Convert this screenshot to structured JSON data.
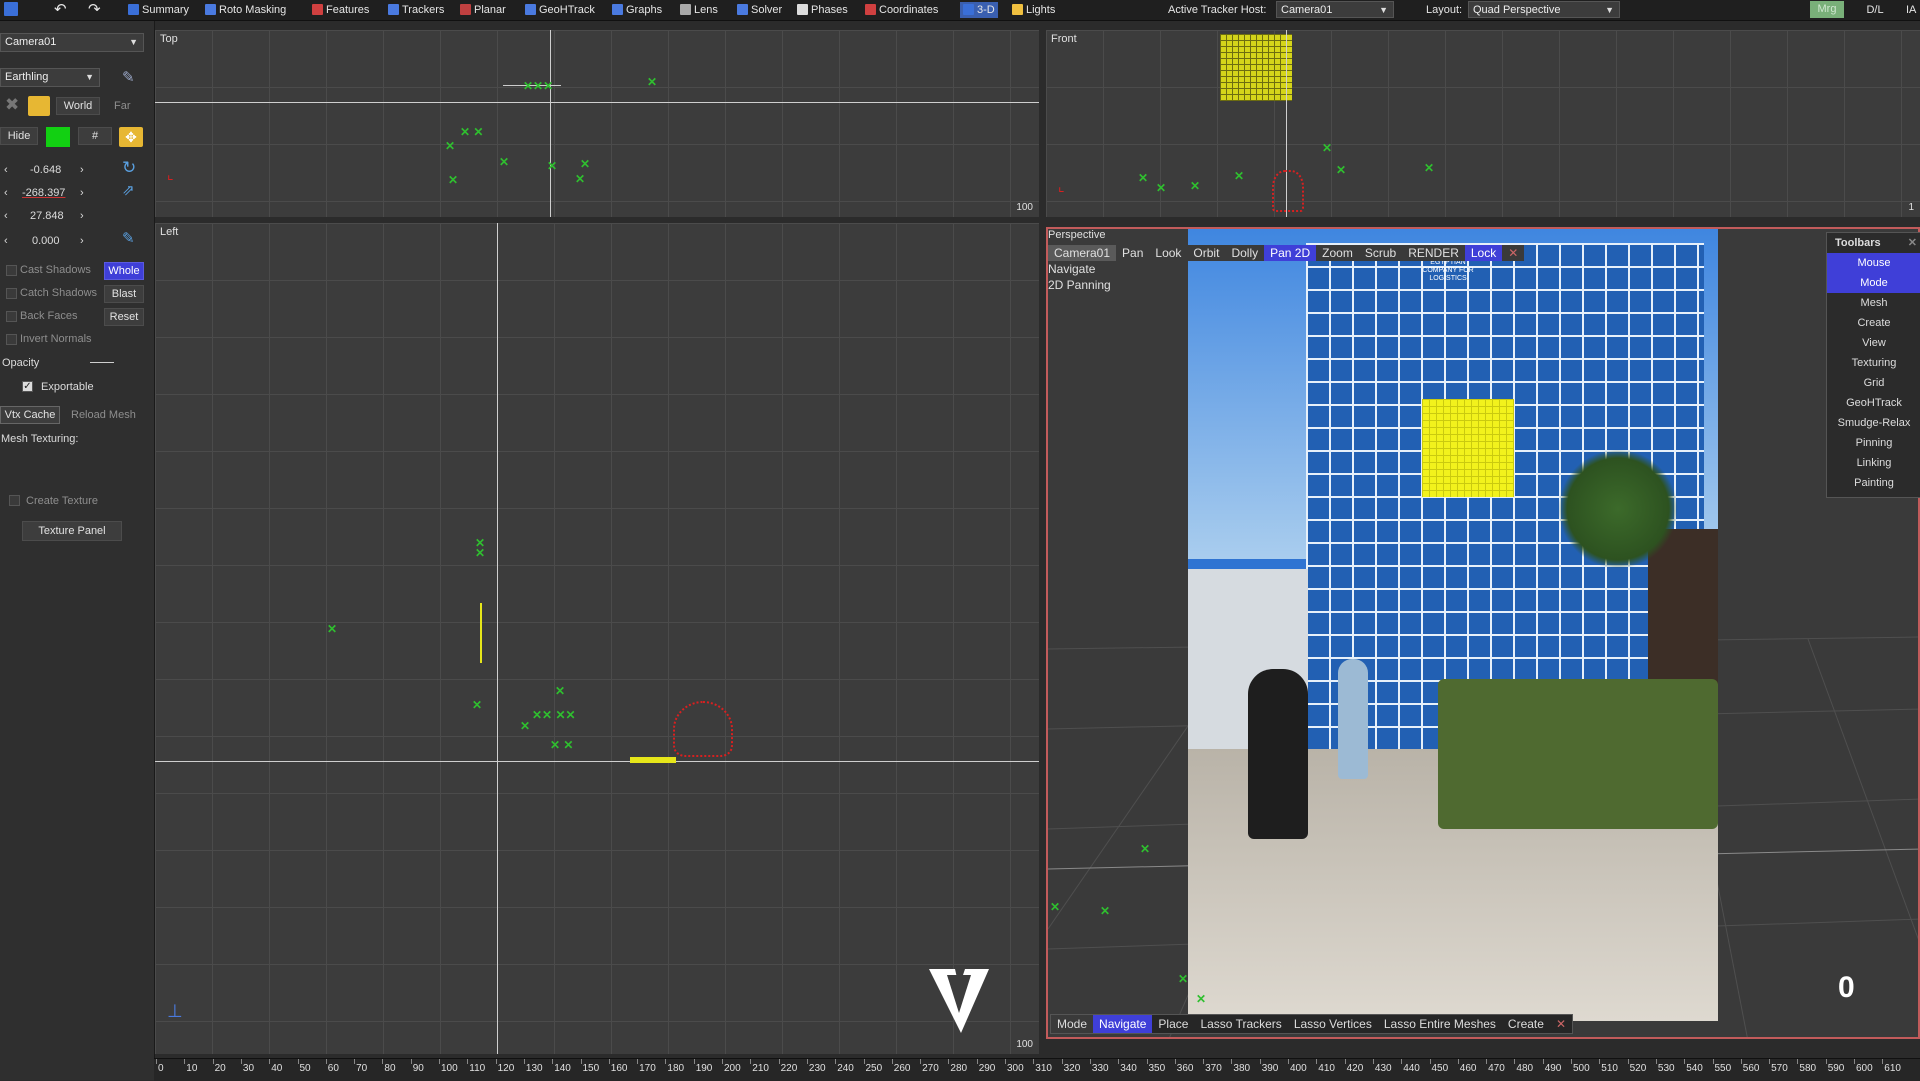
{
  "toolbar": {
    "items": [
      "Summary",
      "Roto Masking",
      "Features",
      "Trackers",
      "Planar",
      "GeoHTrack",
      "Graphs",
      "Lens",
      "Solver",
      "Phases",
      "Coordinates",
      "3-D",
      "Lights"
    ],
    "active_tracker_host_label": "Active Tracker Host:",
    "active_tracker_host_value": "Camera01",
    "layout_label": "Layout:",
    "layout_value": "Quad Perspective",
    "right_buttons": [
      "Mrg",
      "D/L",
      "IA"
    ]
  },
  "left_panel": {
    "camera_select": "Camera01",
    "mesh_select": "Earthling",
    "world_label": "World",
    "far_label": "Far",
    "hide_label": "Hide",
    "hash_label": "#",
    "values": [
      "-0.648",
      "-268.397",
      "27.848",
      "0.000"
    ],
    "cast_shadows": "Cast Shadows",
    "catch_shadows": "Catch Shadows",
    "back_faces": "Back Faces",
    "invert_normals": "Invert Normals",
    "whole_button": "Whole",
    "blast_button": "Blast",
    "reset_button": "Reset",
    "opacity_label": "Opacity",
    "exportable_label": "Exportable",
    "vtx_cache": "Vtx Cache",
    "reload_mesh": "Reload Mesh",
    "mesh_texturing": "Mesh Texturing:",
    "create_texture": "Create Texture",
    "texture_panel": "Texture Panel"
  },
  "viewports": {
    "top_label": "Top",
    "top_scale": "100",
    "front_label": "Front",
    "front_scale": "1",
    "left_label": "Left",
    "left_scale": "100",
    "perspective_label": "Perspective"
  },
  "perspective": {
    "nav_items": [
      "Camera01",
      "Pan",
      "Look",
      "Orbit",
      "Dolly",
      "Pan 2D",
      "Zoom",
      "Scrub",
      "RENDER",
      "Lock"
    ],
    "status_line1": "Navigate",
    "status_line2": "2D Panning",
    "frame_number": "0",
    "sign_text": "EGYPTIAN COMPANY FOR LOGISTICS",
    "toolbars_title": "Toolbars",
    "toolbars_items": [
      "Mouse",
      "Mode",
      "Mesh",
      "Create",
      "View",
      "Texturing",
      "Grid",
      "GeoHTrack",
      "Smudge-Relax",
      "Pinning",
      "Linking",
      "Painting"
    ],
    "bottom_menu": [
      "Mode",
      "Navigate",
      "Place",
      "Lasso Trackers",
      "Lasso Vertices",
      "Lasso Entire Meshes",
      "Create"
    ]
  },
  "timeline": {
    "ticks": [
      "0",
      "10",
      "20",
      "30",
      "40",
      "50",
      "60",
      "70",
      "80",
      "90",
      "100",
      "110",
      "120",
      "130",
      "140",
      "150",
      "160",
      "170",
      "180",
      "190",
      "200",
      "210",
      "220",
      "230",
      "240",
      "250",
      "260",
      "270",
      "280",
      "290",
      "300",
      "310",
      "320",
      "330",
      "340",
      "350",
      "360",
      "370",
      "380",
      "390",
      "400",
      "410",
      "420",
      "430",
      "440",
      "450",
      "460",
      "470",
      "480",
      "490",
      "500",
      "510",
      "520",
      "530",
      "540",
      "550",
      "560",
      "570",
      "580",
      "590",
      "600",
      "610"
    ]
  },
  "colors": {
    "tracker_green": "#2fbf2f",
    "camera_red": "#d82020",
    "mesh_yellow": "#ffff1a",
    "highlight_blue": "#3f3fd8"
  }
}
